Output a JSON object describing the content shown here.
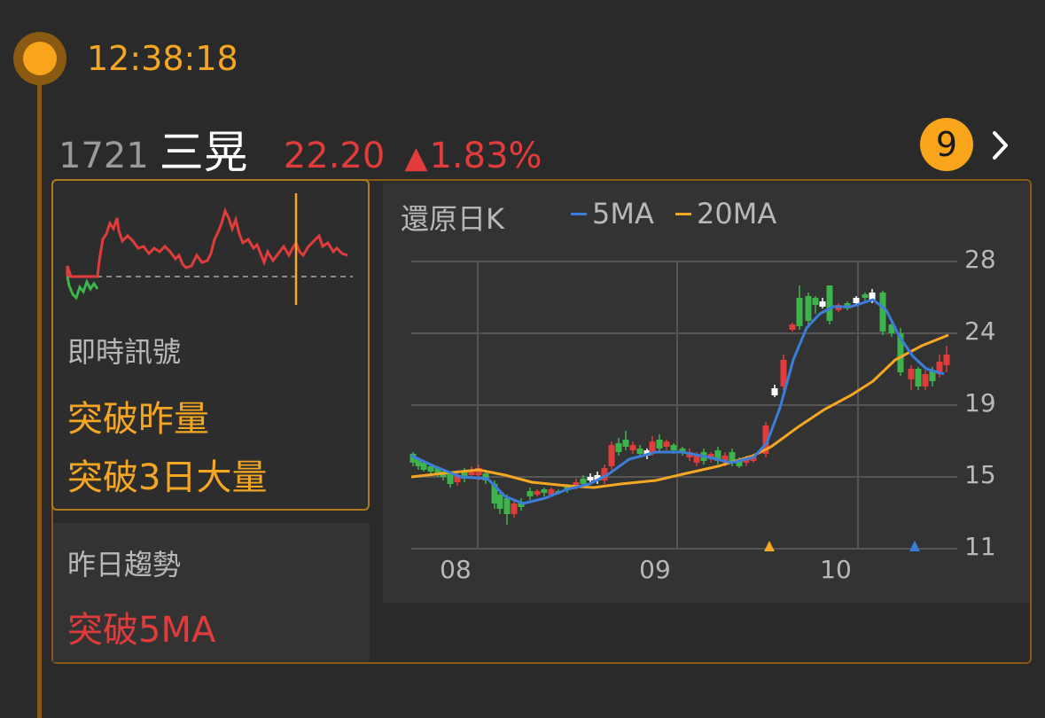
{
  "time": "12:38:18",
  "stock": {
    "code": "1721",
    "name": "三晃",
    "price": "22.20",
    "change": "1.83%",
    "change_icon": "triangle-up"
  },
  "badge_count": "9",
  "intraday": {
    "label": "即時訊號",
    "signals": [
      "突破昨量",
      "突破3日大量"
    ],
    "colors": {
      "up": "#e03c3c",
      "down": "#3cb44b",
      "marker": "#f5a623"
    }
  },
  "trend": {
    "label": "昨日趨勢",
    "value": "突破5MA"
  },
  "kchart": {
    "title": "還原日K",
    "legend": [
      {
        "label": "5MA",
        "color": "#3b7dd8"
      },
      {
        "label": "20MA",
        "color": "#f5a623"
      }
    ],
    "y_ticks": [
      "28",
      "24",
      "19",
      "15",
      "11"
    ],
    "x_ticks": [
      "08",
      "09",
      "10"
    ],
    "colors": {
      "up": "#e03c3c",
      "down": "#3cb44b",
      "flat": "#ffffff"
    },
    "markers": [
      {
        "color": "#f5a623",
        "icon": "triangle-up"
      },
      {
        "color": "#3b7dd8",
        "icon": "triangle-up"
      }
    ]
  }
}
